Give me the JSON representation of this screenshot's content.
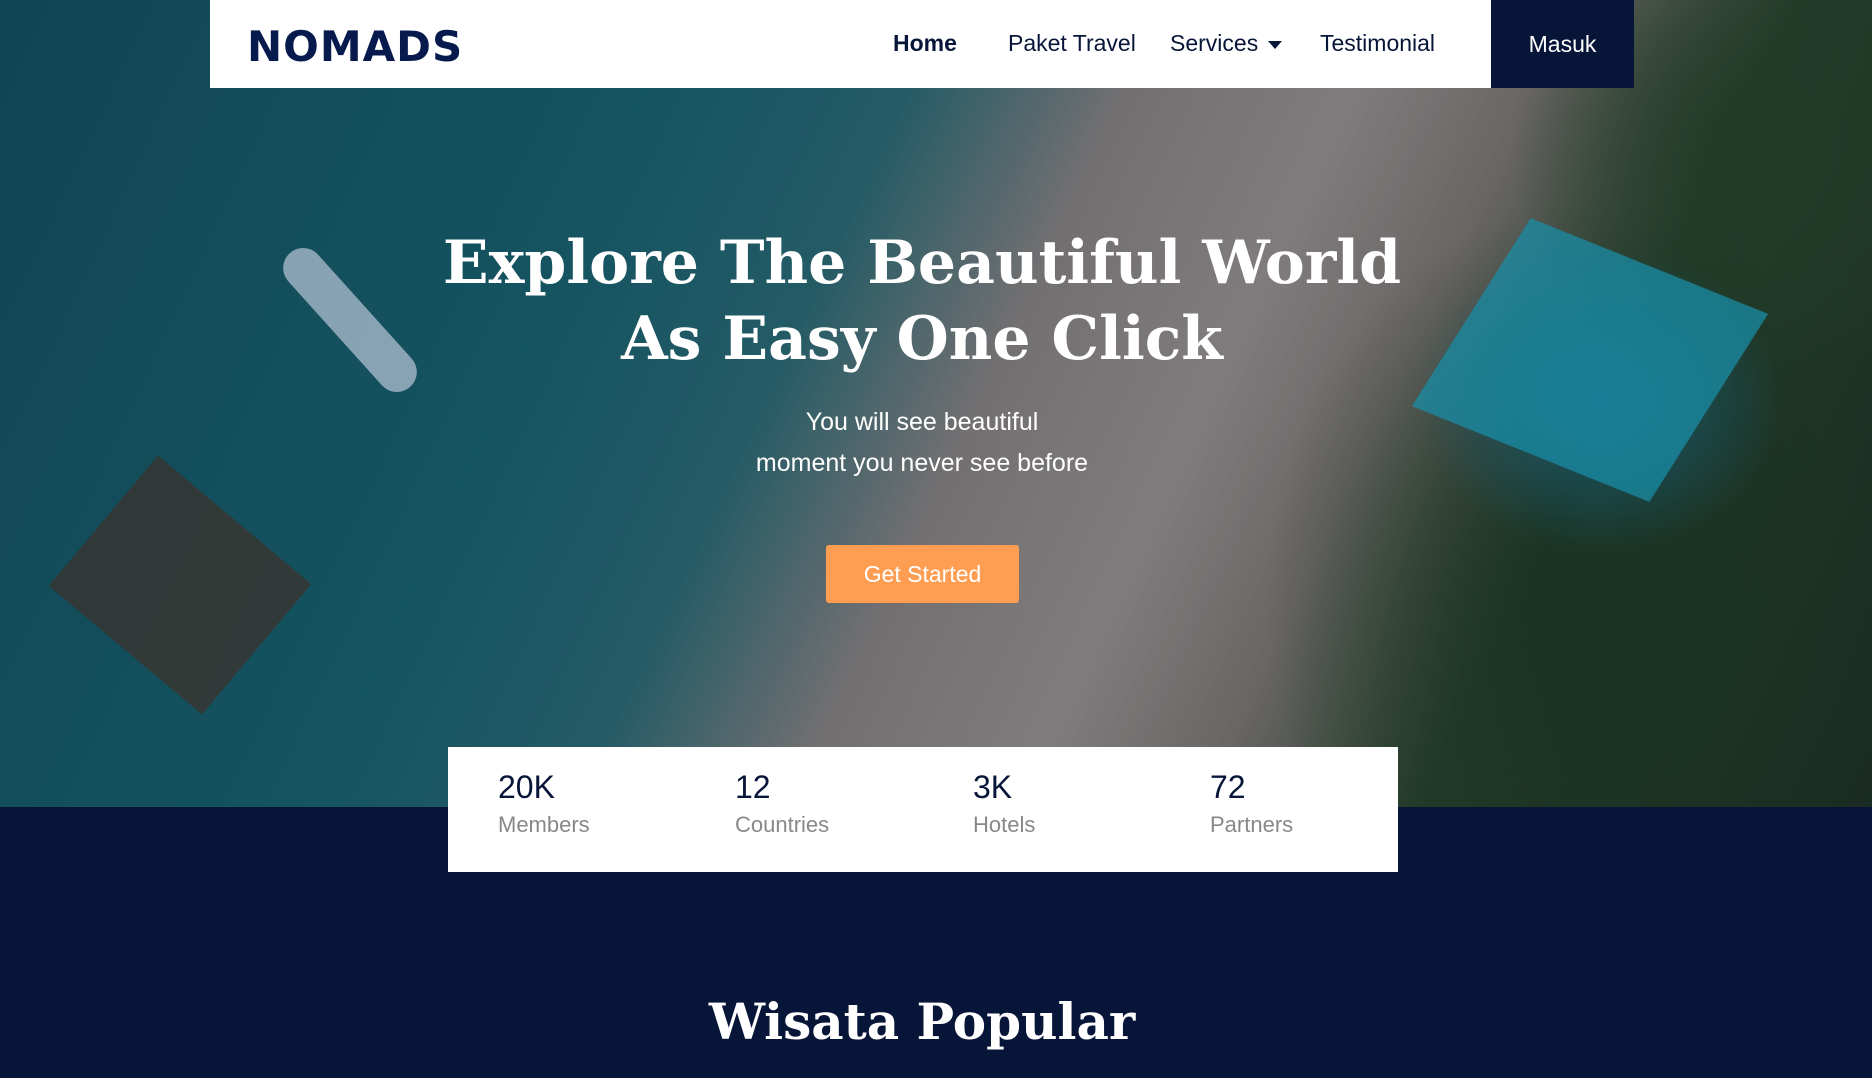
{
  "nav": {
    "logo": "NOMADS",
    "items": [
      "Home",
      "Paket Travel",
      "Services",
      "Testimonial"
    ],
    "login": "Masuk"
  },
  "hero": {
    "title_line1": "Explore The Beautiful World",
    "title_line2": "As Easy One Click",
    "subtitle_line1": "You will see beautiful",
    "subtitle_line2": "moment you never see before",
    "cta": "Get Started"
  },
  "stats": [
    {
      "value": "20K",
      "label": "Members"
    },
    {
      "value": "12",
      "label": "Countries"
    },
    {
      "value": "3K",
      "label": "Hotels"
    },
    {
      "value": "72",
      "label": "Partners"
    }
  ],
  "section": {
    "title": "Wisata Popular"
  },
  "colors": {
    "primary": "#071538",
    "accent": "#ff9e53"
  }
}
